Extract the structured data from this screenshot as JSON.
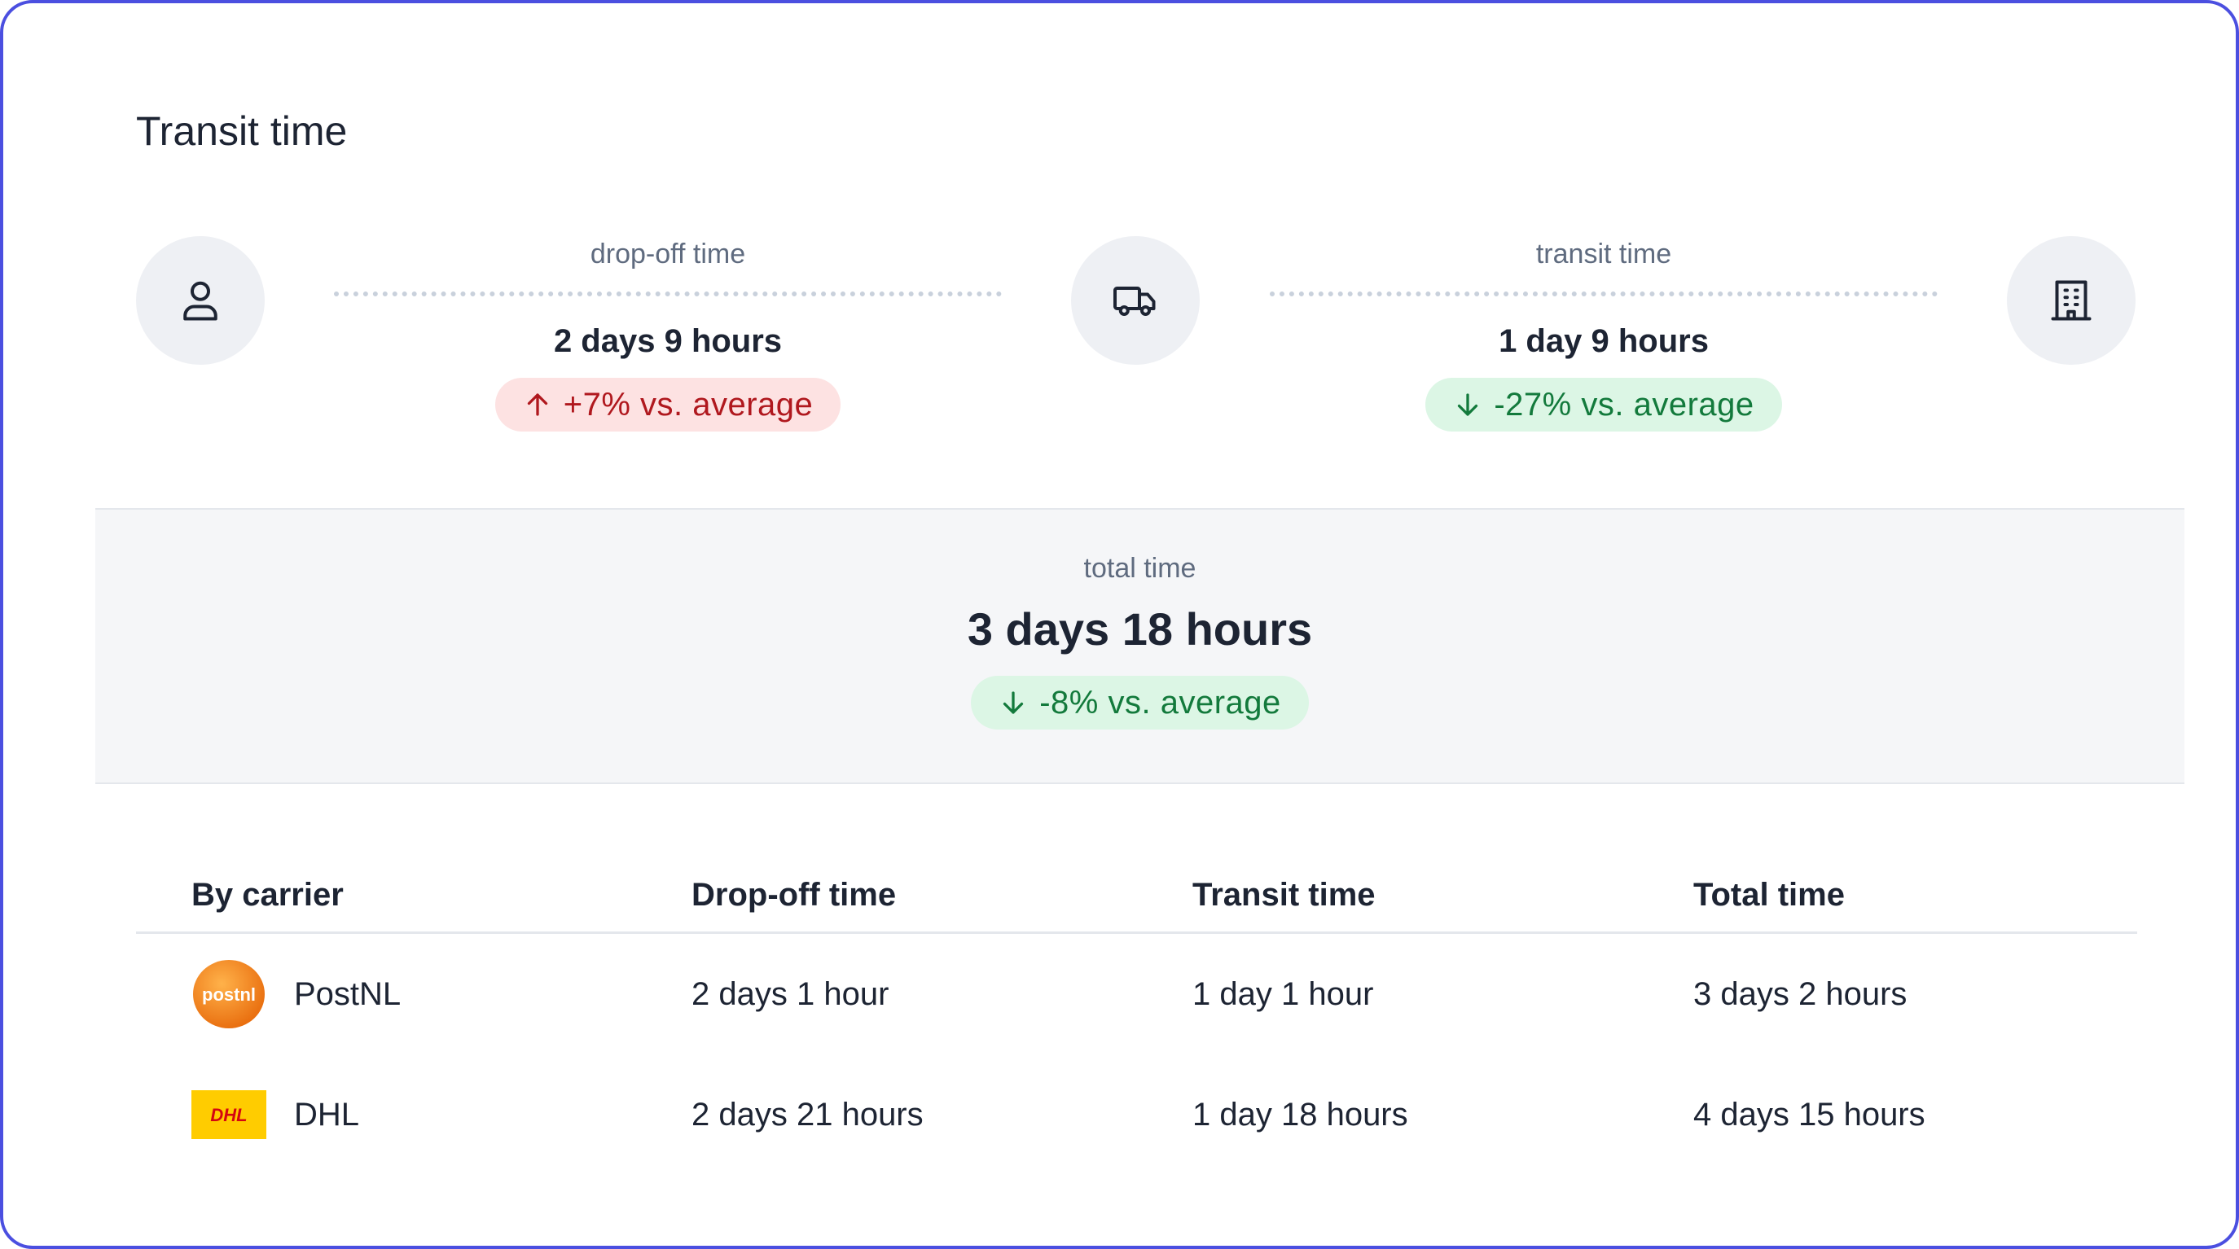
{
  "card": {
    "title": "Transit time"
  },
  "timeline": {
    "icons": {
      "start": "person-icon",
      "middle": "truck-icon",
      "end": "building-icon"
    },
    "dropoff": {
      "label": "drop-off time",
      "value": "2 days 9 hours",
      "delta": "+7% vs. average",
      "direction": "up",
      "color": "#b0181e"
    },
    "transit": {
      "label": "transit time",
      "value": "1 day 9 hours",
      "delta": "-27% vs. average",
      "direction": "down",
      "color": "#137a3c"
    }
  },
  "total": {
    "label": "total time",
    "value": "3 days 18 hours",
    "delta": "-8% vs. average",
    "direction": "down",
    "color": "#137a3c"
  },
  "table": {
    "headers": [
      "By carrier",
      "Drop-off time",
      "Transit time",
      "Total time"
    ],
    "rows": [
      {
        "carrier": "PostNL",
        "logo_text": "postnl",
        "dropoff": "2 days 1 hour",
        "transit": "1 day 1 hour",
        "total": "3 days 2 hours"
      },
      {
        "carrier": "DHL",
        "logo_text": "DHL",
        "dropoff": "2 days 21 hours",
        "transit": "1 day 18 hours",
        "total": "4 days 15 hours"
      }
    ]
  },
  "colors": {
    "border_accent": "#4b4fe0",
    "badge_up_bg": "#fde2e2",
    "badge_down_bg": "#dcf6e5",
    "postnl_orange": "#f08a1c",
    "dhl_yellow": "#ffcc00",
    "dhl_red": "#d40511"
  }
}
